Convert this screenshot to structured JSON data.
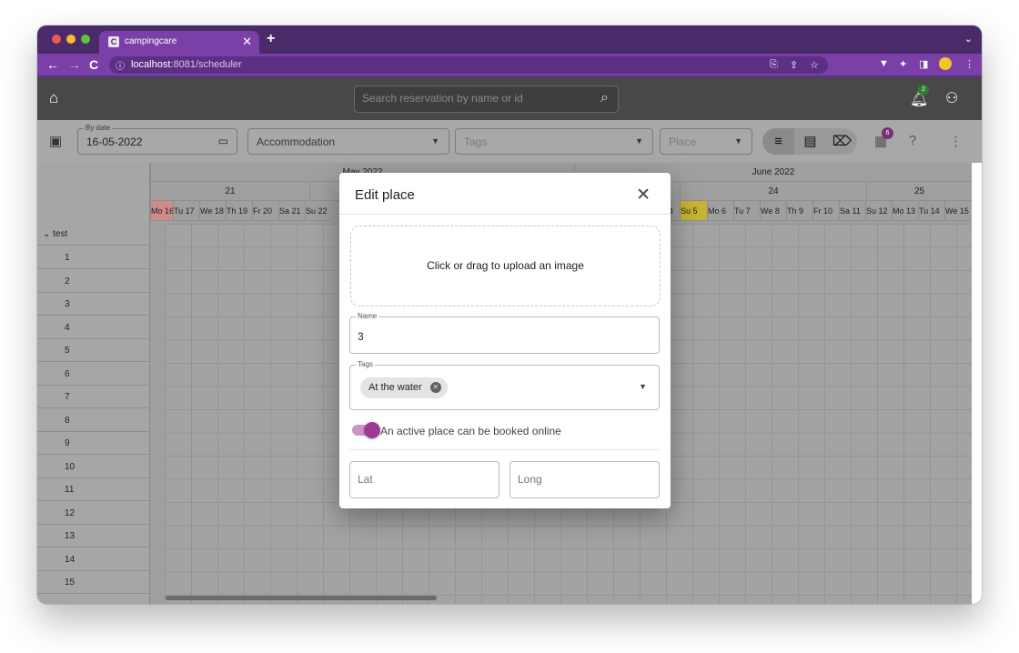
{
  "browser": {
    "tab_title": "campingcare",
    "tab_favicon": "C",
    "url_host": "localhost",
    "url_rest": ":8081/scheduler"
  },
  "header": {
    "search_placeholder": "Search reservation by name or id",
    "notification_count": "2"
  },
  "toolbar": {
    "date_label": "By date",
    "date_value": "16-05-2022",
    "accommodation_placeholder": "Accommodation",
    "tags_placeholder": "Tags",
    "place_placeholder": "Place",
    "reservations_badge": "6"
  },
  "scheduler": {
    "months": [
      "May 2022",
      "June 2022"
    ],
    "weeks": [
      "21",
      "24",
      "25"
    ],
    "days_left": [
      "Mo 16",
      "Tu 17",
      "We 18",
      "Th 19",
      "Fr 20",
      "Sa 21",
      "Su 22"
    ],
    "days_right": [
      "Su 5",
      "Mo 6",
      "Tu 7",
      "We 8",
      "Th 9",
      "Fr 10",
      "Sa 11",
      "Su 12",
      "Mo 13",
      "Tu 14",
      "We 15"
    ],
    "partial_day": "4",
    "group": "test",
    "rows": [
      "1",
      "2",
      "3",
      "4",
      "5",
      "6",
      "7",
      "8",
      "9",
      "10",
      "11",
      "12",
      "13",
      "14",
      "15"
    ]
  },
  "modal": {
    "title": "Edit place",
    "upload_text": "Click or drag to upload an image",
    "name_label": "Name",
    "name_value": "3",
    "tags_label": "Tags",
    "tag_chip": "At the water",
    "active_toggle_label": "An active place can be booked online",
    "active": true,
    "lat_placeholder": "Lat",
    "long_placeholder": "Long"
  },
  "colors": {
    "browser_frame": "#4b2a6a",
    "browser_tab": "#7a40a8",
    "app_header": "#484848",
    "accent": "#9c3b96",
    "today_highlight": "#cf8a8a",
    "selected_day": "#c5b331"
  }
}
